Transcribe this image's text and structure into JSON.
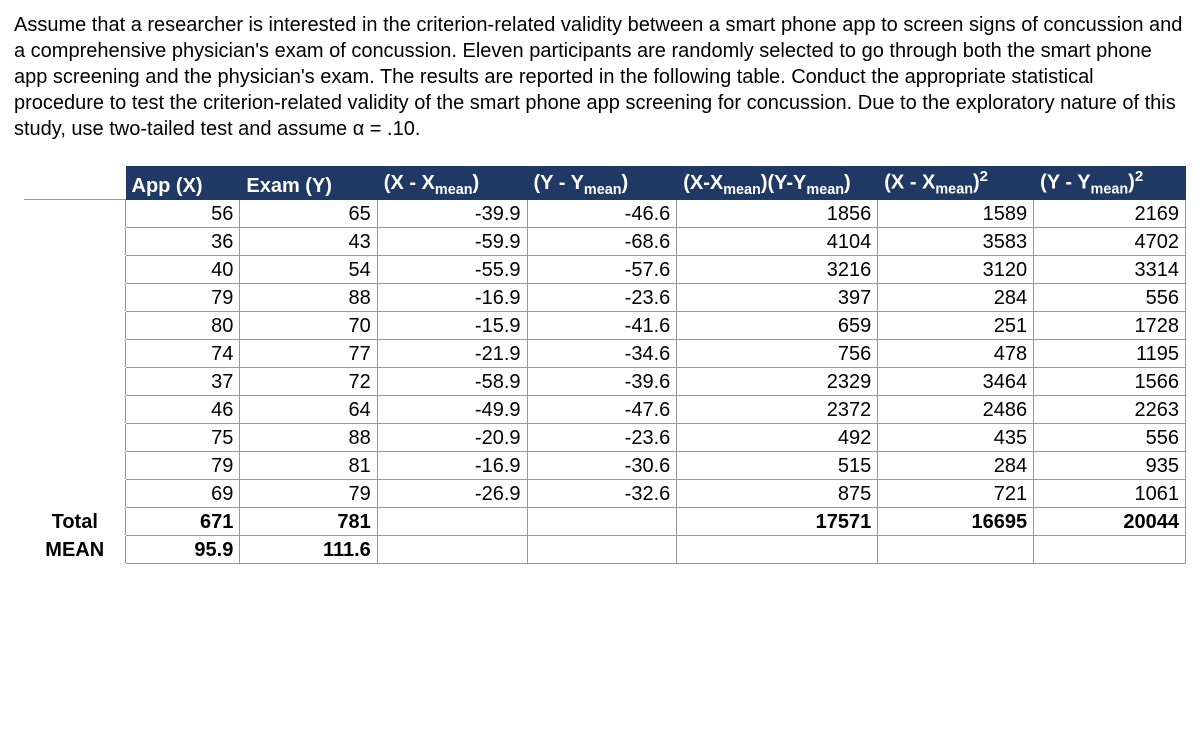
{
  "prompt": "Assume that a researcher is interested in the criterion-related validity between a smart phone app to screen signs of concussion and a comprehensive physician's exam of concussion. Eleven participants are randomly selected to go through both the smart phone app screening and the physician's exam. The results are reported in the following table. Conduct the appropriate statistical procedure to test the criterion-related validity of the smart phone app screening for concussion. Due to the exploratory nature of this study, use two-tailed test and assume α = .10.",
  "headers": {
    "c1": "App (X)",
    "c2": "Exam (Y)",
    "c3_pre": "(X - X",
    "c3_sub": "mean",
    "c3_post": ")",
    "c4_pre": "(Y - Y",
    "c4_sub": "mean",
    "c4_post": ")",
    "c5_pre": "(X-X",
    "c5_sub1": "mean",
    "c5_mid": ")(Y-Y",
    "c5_sub2": "mean",
    "c5_post": ")",
    "c6_pre": "(X - X",
    "c6_sub": "mean",
    "c6_post": ")",
    "c6_sup": "2",
    "c7_pre": "(Y - Y",
    "c7_sub": "mean",
    "c7_post": ")",
    "c7_sup": "2"
  },
  "rows": [
    {
      "x": "56",
      "y": "65",
      "dx": "-39.9",
      "dy": "-46.6",
      "p": "1856",
      "sx": "1589",
      "sy": "2169"
    },
    {
      "x": "36",
      "y": "43",
      "dx": "-59.9",
      "dy": "-68.6",
      "p": "4104",
      "sx": "3583",
      "sy": "4702"
    },
    {
      "x": "40",
      "y": "54",
      "dx": "-55.9",
      "dy": "-57.6",
      "p": "3216",
      "sx": "3120",
      "sy": "3314"
    },
    {
      "x": "79",
      "y": "88",
      "dx": "-16.9",
      "dy": "-23.6",
      "p": "397",
      "sx": "284",
      "sy": "556"
    },
    {
      "x": "80",
      "y": "70",
      "dx": "-15.9",
      "dy": "-41.6",
      "p": "659",
      "sx": "251",
      "sy": "1728"
    },
    {
      "x": "74",
      "y": "77",
      "dx": "-21.9",
      "dy": "-34.6",
      "p": "756",
      "sx": "478",
      "sy": "1195"
    },
    {
      "x": "37",
      "y": "72",
      "dx": "-58.9",
      "dy": "-39.6",
      "p": "2329",
      "sx": "3464",
      "sy": "1566"
    },
    {
      "x": "46",
      "y": "64",
      "dx": "-49.9",
      "dy": "-47.6",
      "p": "2372",
      "sx": "2486",
      "sy": "2263"
    },
    {
      "x": "75",
      "y": "88",
      "dx": "-20.9",
      "dy": "-23.6",
      "p": "492",
      "sx": "435",
      "sy": "556"
    },
    {
      "x": "79",
      "y": "81",
      "dx": "-16.9",
      "dy": "-30.6",
      "p": "515",
      "sx": "284",
      "sy": "935"
    },
    {
      "x": "69",
      "y": "79",
      "dx": "-26.9",
      "dy": "-32.6",
      "p": "875",
      "sx": "721",
      "sy": "1061"
    }
  ],
  "total": {
    "label": "Total",
    "x": "671",
    "y": "781",
    "p": "17571",
    "sx": "16695",
    "sy": "20044"
  },
  "mean": {
    "label": "MEAN",
    "x": "95.9",
    "y": "111.6"
  }
}
